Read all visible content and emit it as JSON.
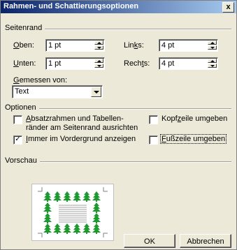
{
  "dialog": {
    "title": "Rahmen- und Schattierungsoptionen",
    "close_glyph": "x"
  },
  "seitenrand": {
    "group_label": "Seitenrand",
    "oben": {
      "label_u": "O",
      "label_rest": "ben:",
      "value": "1 pt"
    },
    "unten": {
      "label_u": "U",
      "label_rest": "nten:",
      "value": "1 pt"
    },
    "links": {
      "label_pre": "Lin",
      "label_u": "k",
      "label_rest": "s:",
      "value": "4 pt"
    },
    "rechts": {
      "label_pre": "Rech",
      "label_u": "t",
      "label_rest": "s:",
      "value": "4 pt"
    },
    "gemessen": {
      "label_u": "G",
      "label_rest": "emessen von:",
      "value": "Text"
    }
  },
  "optionen": {
    "group_label": "Optionen",
    "absatz": {
      "label_u": "A",
      "label_rest": "bsatzrahmen und Tabellen-",
      "label_line2": "ränder am Seitenrand ausrichten",
      "checked": false
    },
    "vordergrund": {
      "label_u": "I",
      "label_rest": "mmer im Vordergrund anzeigen",
      "checked": true,
      "check_glyph": "✓"
    },
    "kopfzeile": {
      "label_pre": "Kopf",
      "label_u": "z",
      "label_rest": "eile umgeben",
      "checked": false
    },
    "fusszeile": {
      "label_u": "F",
      "label_rest": "ußzeile umgeben",
      "checked": false
    }
  },
  "vorschau": {
    "group_label": "Vorschau"
  },
  "buttons": {
    "ok": "OK",
    "cancel": "Abbrechen"
  },
  "colors": {
    "tree_green": "#1c9a2e",
    "dialog_bg": "#ece9d8",
    "title_start": "#0a246a",
    "title_end": "#a6caf0"
  }
}
